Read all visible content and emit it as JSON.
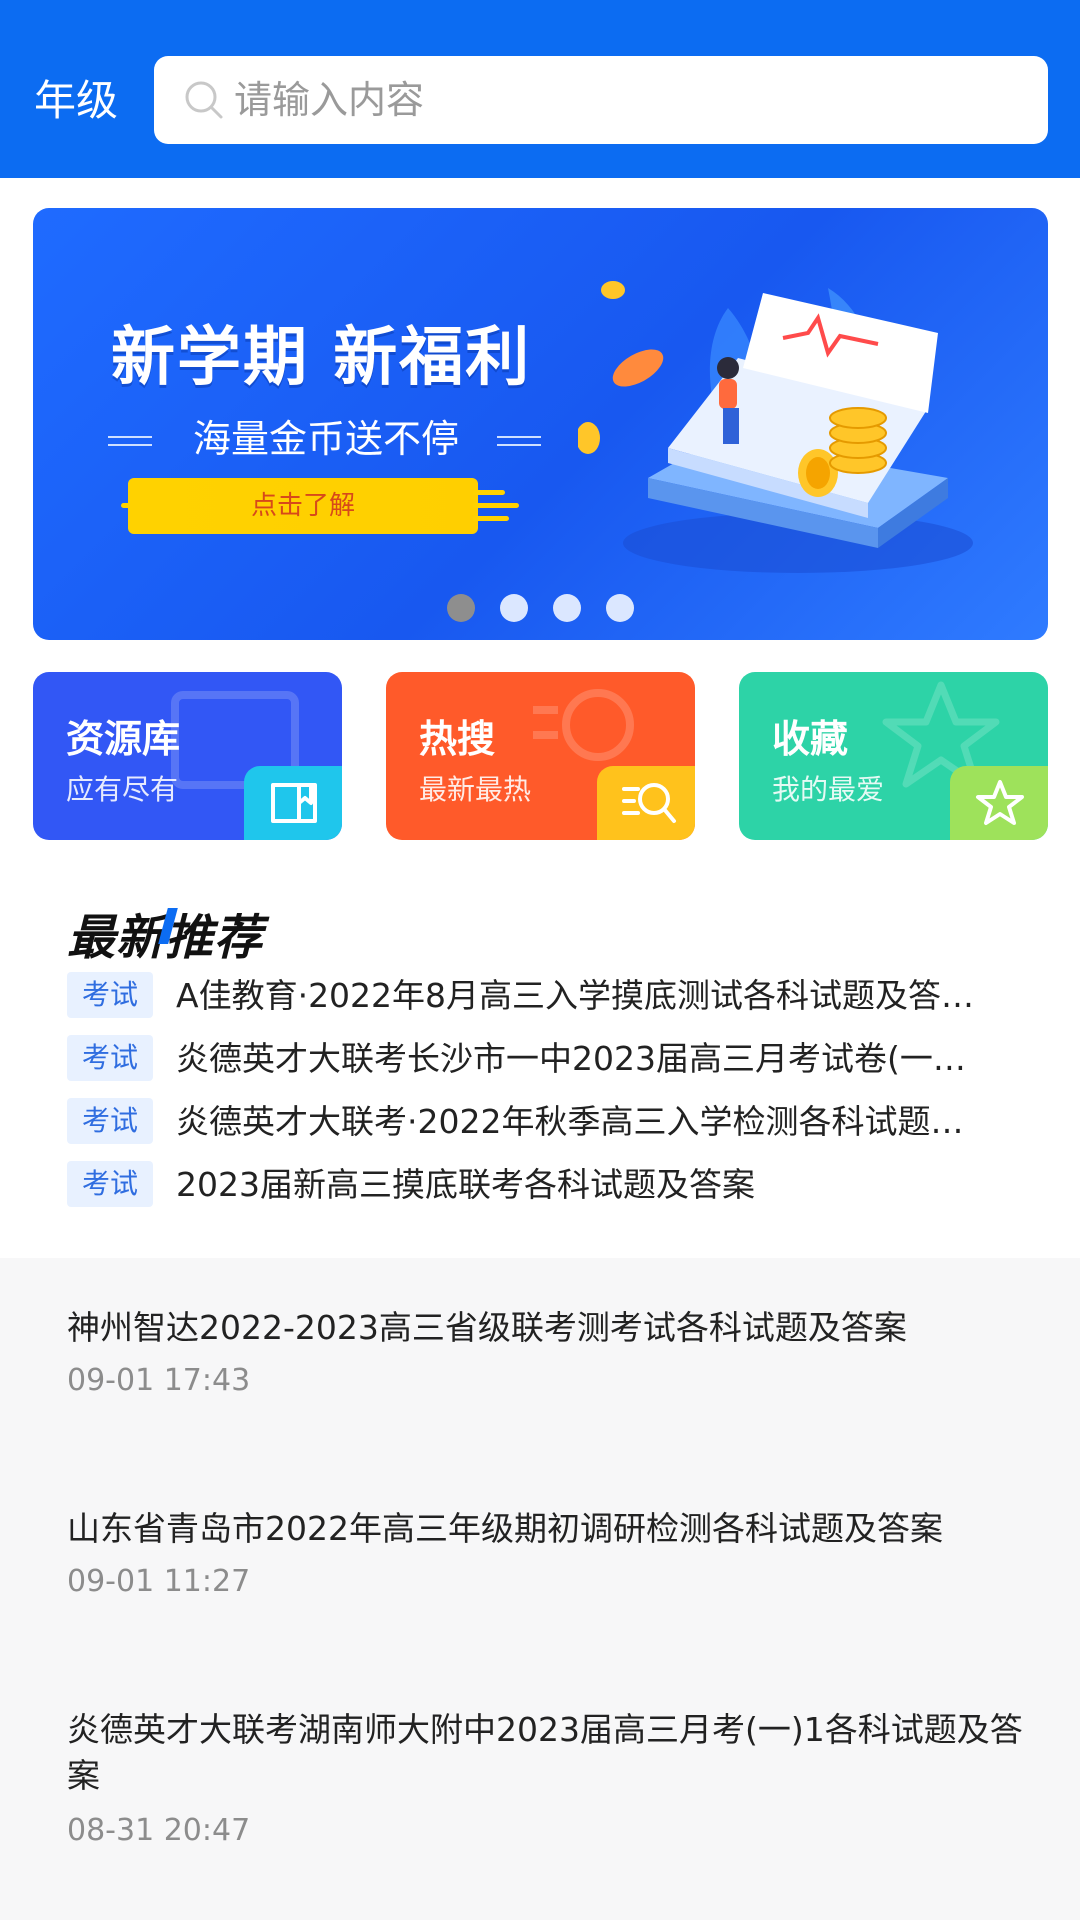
{
  "header": {
    "grade_label": "年级",
    "search": {
      "placeholder": "请输入内容",
      "value": ""
    }
  },
  "banner": {
    "title": "新学期  新福利",
    "subtitle": "海量金币送不停",
    "cta_label": "点击了解",
    "slide_count": 4,
    "active_slide": 1
  },
  "cards": [
    {
      "title": "资源库",
      "subtitle": "应有尽有",
      "icon": "folder-icon",
      "color": "#3257f5",
      "badge_color": "#1fc6ec"
    },
    {
      "title": "热搜",
      "subtitle": "最新最热",
      "icon": "hot-search-icon",
      "color": "#ff5a2a",
      "badge_color": "#ffc21c"
    },
    {
      "title": "收藏",
      "subtitle": "我的最爱",
      "icon": "star-icon",
      "color": "#2dd3a7",
      "badge_color": "#9ee25b"
    }
  ],
  "recommend": {
    "title": "最新推荐",
    "items": [
      {
        "tag": "考试",
        "text": "A佳教育·2022年8月高三入学摸底测试各科试题及答…"
      },
      {
        "tag": "考试",
        "text": "炎德英才大联考长沙市一中2023届高三月考试卷(一…"
      },
      {
        "tag": "考试",
        "text": "炎德英才大联考·2022年秋季高三入学检测各科试题…"
      },
      {
        "tag": "考试",
        "text": "2023届新高三摸底联考各科试题及答案"
      }
    ]
  },
  "articles": [
    {
      "title": "神州智达2022-2023高三省级联考测考试各科试题及答案",
      "time": "09-01 17:43"
    },
    {
      "title": "山东省青岛市2022年高三年级期初调研检测各科试题及答案",
      "time": "09-01 11:27"
    },
    {
      "title": "炎德英才大联考湖南师大附中2023届高三月考(一)1各科试题及答案",
      "time": "08-31 20:47"
    }
  ],
  "colors": {
    "primary": "#0c6cf2",
    "tag_bg": "#e8f1ff",
    "tag_text": "#2f6de0",
    "feed_bg": "#f7f7f8"
  }
}
